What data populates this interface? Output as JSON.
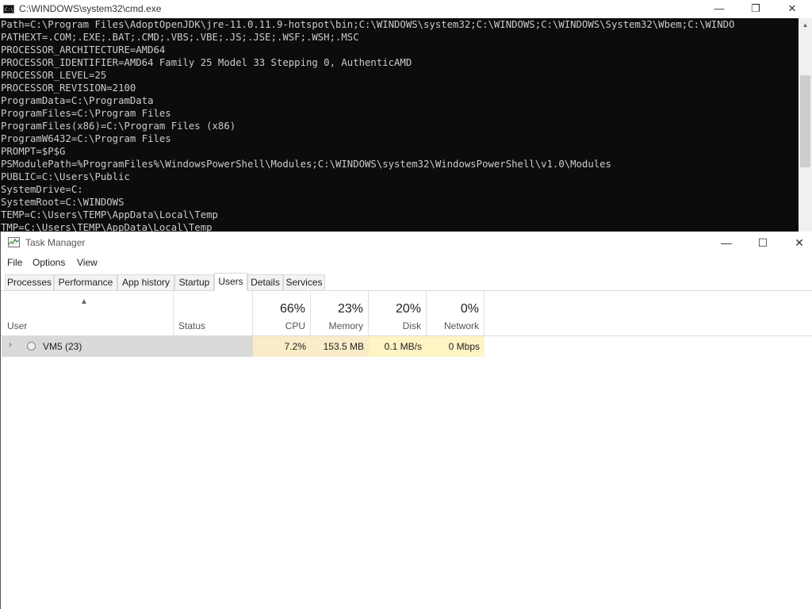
{
  "cmd": {
    "title": "C:\\WINDOWS\\system32\\cmd.exe",
    "icon_label": "C:\\",
    "lines": [
      "Path=C:\\Program Files\\AdoptOpenJDK\\jre-11.0.11.9-hotspot\\bin;C:\\WINDOWS\\system32;C:\\WINDOWS;C:\\WINDOWS\\System32\\Wbem;C:\\WINDO",
      "PATHEXT=.COM;.EXE;.BAT;.CMD;.VBS;.VBE;.JS;.JSE;.WSF;.WSH;.MSC",
      "PROCESSOR_ARCHITECTURE=AMD64",
      "PROCESSOR_IDENTIFIER=AMD64 Family 25 Model 33 Stepping 0, AuthenticAMD",
      "PROCESSOR_LEVEL=25",
      "PROCESSOR_REVISION=2100",
      "ProgramData=C:\\ProgramData",
      "ProgramFiles=C:\\Program Files",
      "ProgramFiles(x86)=C:\\Program Files (x86)",
      "ProgramW6432=C:\\Program Files",
      "PROMPT=$P$G",
      "PSModulePath=%ProgramFiles%\\WindowsPowerShell\\Modules;C:\\WINDOWS\\system32\\WindowsPowerShell\\v1.0\\Modules",
      "PUBLIC=C:\\Users\\Public",
      "SystemDrive=C:",
      "SystemRoot=C:\\WINDOWS",
      "TEMP=C:\\Users\\TEMP\\AppData\\Local\\Temp",
      "TMP=C:\\Users\\TEMP\\AppData\\Local\\Temp"
    ],
    "controls": {
      "minimize": "—",
      "restore": "❐",
      "close": "✕"
    }
  },
  "task_manager": {
    "title": "Task Manager",
    "menu": {
      "file": "File",
      "options": "Options",
      "view": "View"
    },
    "tabs": [
      "Processes",
      "Performance",
      "App history",
      "Startup",
      "Users",
      "Details",
      "Services"
    ],
    "active_tab": "Users",
    "controls": {
      "minimize": "—",
      "maximize": "☐",
      "close": "✕"
    },
    "columns": {
      "user": "User",
      "status": "Status",
      "cpu": {
        "percent": "66%",
        "label": "CPU"
      },
      "memory": {
        "percent": "23%",
        "label": "Memory"
      },
      "disk": {
        "percent": "20%",
        "label": "Disk"
      },
      "network": {
        "percent": "0%",
        "label": "Network"
      }
    },
    "rows": [
      {
        "user": "VM5 (23)",
        "status": "",
        "cpu": "7.2%",
        "memory": "153.5 MB",
        "disk": "0.1 MB/s",
        "network": "0 Mbps"
      }
    ],
    "colors": {
      "heat_high": "#f9ecc8",
      "heat_low": "#fff4c4",
      "selected_row": "#d9d9d9"
    }
  }
}
